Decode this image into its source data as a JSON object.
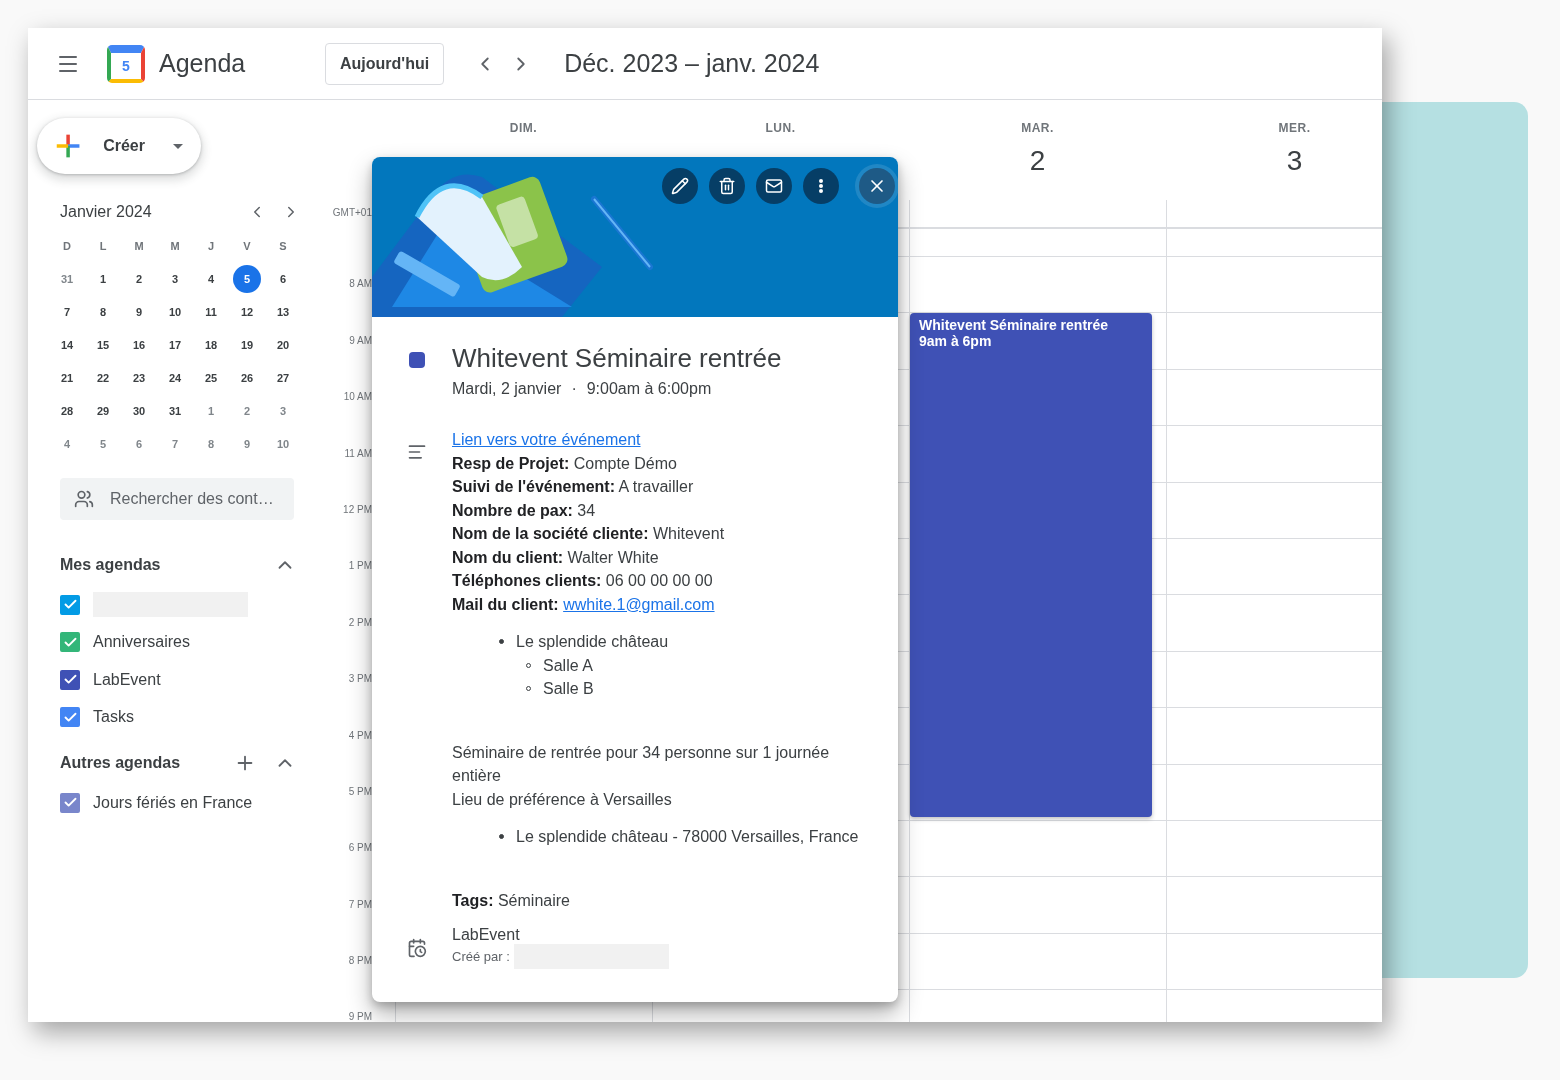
{
  "header": {
    "app_name": "Agenda",
    "logo_day": "5",
    "today_button": "Aujourd'hui",
    "date_range": "Déc. 2023 – janv. 2024"
  },
  "sidebar": {
    "create_button": "Créer",
    "mini_calendar": {
      "month": "Janvier 2024",
      "weekdays": [
        "D",
        "L",
        "M",
        "M",
        "J",
        "V",
        "S"
      ],
      "weeks": [
        [
          {
            "day": "31",
            "other_month": true,
            "selected": false
          },
          {
            "day": "1",
            "other_month": false,
            "selected": false
          },
          {
            "day": "2",
            "other_month": false,
            "selected": false
          },
          {
            "day": "3",
            "other_month": false,
            "selected": false
          },
          {
            "day": "4",
            "other_month": false,
            "selected": false
          },
          {
            "day": "5",
            "other_month": false,
            "selected": true
          },
          {
            "day": "6",
            "other_month": false,
            "selected": false
          }
        ],
        [
          {
            "day": "7",
            "other_month": false,
            "selected": false
          },
          {
            "day": "8",
            "other_month": false,
            "selected": false
          },
          {
            "day": "9",
            "other_month": false,
            "selected": false
          },
          {
            "day": "10",
            "other_month": false,
            "selected": false
          },
          {
            "day": "11",
            "other_month": false,
            "selected": false
          },
          {
            "day": "12",
            "other_month": false,
            "selected": false
          },
          {
            "day": "13",
            "other_month": false,
            "selected": false
          }
        ],
        [
          {
            "day": "14",
            "other_month": false,
            "selected": false
          },
          {
            "day": "15",
            "other_month": false,
            "selected": false
          },
          {
            "day": "16",
            "other_month": false,
            "selected": false
          },
          {
            "day": "17",
            "other_month": false,
            "selected": false
          },
          {
            "day": "18",
            "other_month": false,
            "selected": false
          },
          {
            "day": "19",
            "other_month": false,
            "selected": false
          },
          {
            "day": "20",
            "other_month": false,
            "selected": false
          }
        ],
        [
          {
            "day": "21",
            "other_month": false,
            "selected": false
          },
          {
            "day": "22",
            "other_month": false,
            "selected": false
          },
          {
            "day": "23",
            "other_month": false,
            "selected": false
          },
          {
            "day": "24",
            "other_month": false,
            "selected": false
          },
          {
            "day": "25",
            "other_month": false,
            "selected": false
          },
          {
            "day": "26",
            "other_month": false,
            "selected": false
          },
          {
            "day": "27",
            "other_month": false,
            "selected": false
          }
        ],
        [
          {
            "day": "28",
            "other_month": false,
            "selected": false
          },
          {
            "day": "29",
            "other_month": false,
            "selected": false
          },
          {
            "day": "30",
            "other_month": false,
            "selected": false
          },
          {
            "day": "31",
            "other_month": false,
            "selected": false
          },
          {
            "day": "1",
            "other_month": true,
            "selected": false
          },
          {
            "day": "2",
            "other_month": true,
            "selected": false
          },
          {
            "day": "3",
            "other_month": true,
            "selected": false
          }
        ],
        [
          {
            "day": "4",
            "other_month": true,
            "selected": false
          },
          {
            "day": "5",
            "other_month": true,
            "selected": false
          },
          {
            "day": "6",
            "other_month": true,
            "selected": false
          },
          {
            "day": "7",
            "other_month": true,
            "selected": false
          },
          {
            "day": "8",
            "other_month": true,
            "selected": false
          },
          {
            "day": "9",
            "other_month": true,
            "selected": false
          },
          {
            "day": "10",
            "other_month": true,
            "selected": false
          }
        ]
      ]
    },
    "search": {
      "placeholder": "Rechercher des cont…"
    },
    "my_calendars": {
      "title": "Mes agendas",
      "expanded": true,
      "items": [
        {
          "redacted": true,
          "checked": true,
          "color": "#039be5"
        },
        {
          "label": "Anniversaires",
          "checked": true,
          "color": "#33b679"
        },
        {
          "label": "LabEvent",
          "checked": true,
          "color": "#3f51b5"
        },
        {
          "label": "Tasks",
          "checked": true,
          "color": "#4285f4"
        }
      ]
    },
    "other_calendars": {
      "title": "Autres agendas",
      "expanded": true,
      "items": [
        {
          "label": "Jours fériés en France",
          "checked": true,
          "color": "#7986cb"
        }
      ]
    }
  },
  "grid": {
    "timezone": "GMT+01",
    "hours": [
      "8 AM",
      "9 AM",
      "10 AM",
      "11 AM",
      "12 PM",
      "1 PM",
      "2 PM",
      "3 PM",
      "4 PM",
      "5 PM",
      "6 PM",
      "7 PM",
      "8 PM",
      "9 PM"
    ],
    "days": [
      {
        "name": "DIM."
      },
      {
        "name": "LUN."
      },
      {
        "name": "MAR.",
        "number": "2",
        "events": [
          {
            "title": "Whitevent Séminaire rentrée",
            "time": "9am à 6pm",
            "color": "#3f51b5"
          }
        ]
      },
      {
        "name": "MER.",
        "number": "3"
      }
    ]
  },
  "popup": {
    "title": "Whitevent Séminaire rentrée",
    "color": "#3f51b5",
    "date": "Mardi, 2 janvier",
    "separator": "·",
    "time": "9:00am à 6:00pm",
    "link": "Lien vers votre événement",
    "fields": [
      {
        "kind": "text",
        "text": "**Resp de Projet:** Compte Démo"
      },
      {
        "kind": "text",
        "text": "**Suivi de l'événement:** A travailler"
      },
      {
        "kind": "text",
        "text": "**Nombre de pax:** 34"
      },
      {
        "kind": "text",
        "text": "**Nom de la société cliente:** Whitevent"
      },
      {
        "kind": "text",
        "text": "**Nom du client:** Walter White"
      },
      {
        "kind": "text",
        "text": "**Téléphones clients:** 06 00 00 00 00"
      },
      {
        "kind": "email",
        "label": "Mail du client:",
        "value": "wwhite.1@gmail.com"
      }
    ],
    "venues": [
      {
        "text": "Le splendide château",
        "children": [
          {
            "text": "Salle A"
          },
          {
            "text": "Salle B"
          }
        ]
      }
    ],
    "notes": [
      "Séminaire de rentrée pour 34 personne sur 1 journée entière",
      "Lieu de préférence à Versailles"
    ],
    "addresses": [
      {
        "text": "Le splendide château - 78000 Versailles, France"
      }
    ],
    "tags": "**Tags:** Séminaire",
    "calendar": "LabEvent",
    "created_by": "Créé par :"
  }
}
